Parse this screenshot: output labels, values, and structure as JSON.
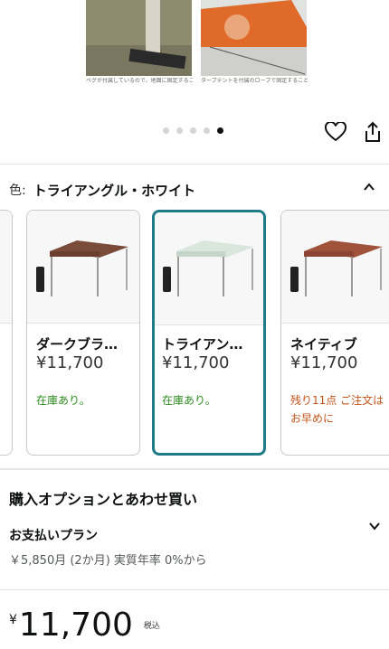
{
  "gallery": {
    "caption_left": "ペグが付属しているので、地面に固定することもできます。",
    "caption_right": "タープテントを付属のロープで固定することも可能です。",
    "page_count": 5,
    "active_index": 4
  },
  "variation": {
    "label": "色:",
    "selected": "トライアングル・ホワイト",
    "options": [
      {
        "name": "ダークブラ…",
        "price": "¥11,700",
        "stock": "在庫あり。",
        "stock_state": "in_stock",
        "canopy_color": "#7b4b3a",
        "selected": false
      },
      {
        "name": "トライアン…",
        "price": "¥11,700",
        "stock": "在庫あり。",
        "stock_state": "in_stock",
        "canopy_color": "#d9e6dc",
        "selected": true
      },
      {
        "name": "ネイティブ",
        "price": "¥11,700",
        "stock": "残り11点 ご注文はお早めに",
        "stock_state": "low",
        "canopy_color": "#a0533b",
        "selected": false
      }
    ]
  },
  "purchase_options": {
    "title": "購入オプションとあわせ買い",
    "plan_title": "お支払いプラン",
    "plan_detail": "￥5,850月 (2か月) 実質年率 0%から"
  },
  "price": {
    "currency": "¥",
    "amount": "11,700",
    "tax_note": "税込"
  },
  "colors": {
    "accent_selected": "#1f7b86",
    "in_stock": "#2d8a1f",
    "low_stock": "#c4531a"
  }
}
